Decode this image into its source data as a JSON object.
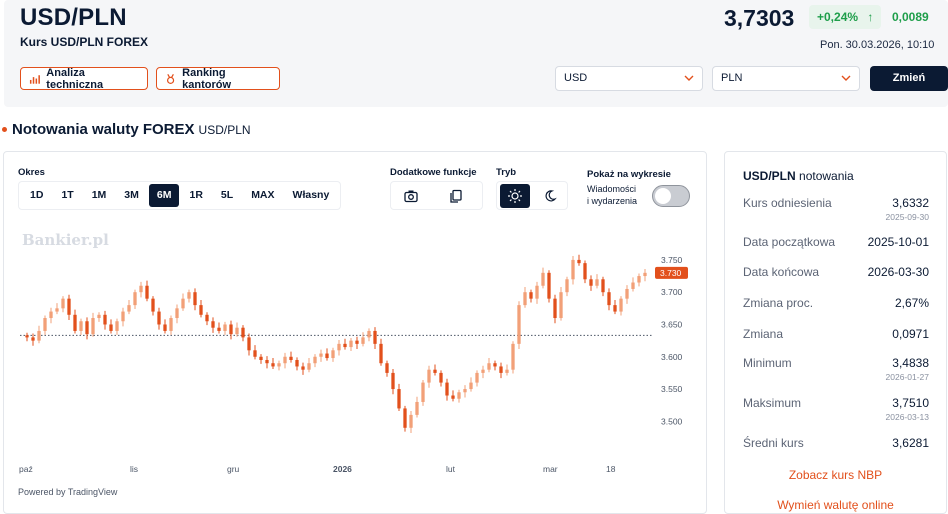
{
  "header": {
    "pair": "USD/PLN",
    "subtitle": "Kurs USD/PLN FOREX",
    "price": "3,7303",
    "change_pct": "+0,24%",
    "change_arrow": "↑",
    "change_abs": "0,0089",
    "datetime": "Pon. 30.03.2026, 10:10",
    "analysis_button": "Analiza techniczna",
    "ranking_button": "Ranking kantorów",
    "from_currency": "USD",
    "to_currency": "PLN",
    "change_button": "Zmień"
  },
  "section": {
    "title": "Notowania waluty FOREX",
    "subtitle": "USD/PLN"
  },
  "controls": {
    "period_label": "Okres",
    "periods": [
      "1D",
      "1T",
      "1M",
      "3M",
      "6M",
      "1R",
      "5L",
      "MAX",
      "Własny"
    ],
    "active_period": "6M",
    "extra_label": "Dodatkowe funkcje",
    "mode_label": "Tryb",
    "show_label": "Pokaż na wykresie",
    "toggle_label_1": "Wiadomości",
    "toggle_label_2": "i wydarzenia",
    "toggle_on": false
  },
  "chart_data": {
    "type": "candlestick",
    "watermark": "Bankier.pl",
    "powered_by": "Powered by TradingView",
    "x_tick_labels": [
      "paź",
      "lis",
      "gru",
      "2026",
      "lut",
      "mar",
      "18"
    ],
    "y_ticks": [
      "3.750",
      "3.700",
      "3.650",
      "3.600",
      "3.550",
      "3.500"
    ],
    "y_range": [
      3.468,
      3.77
    ],
    "reference_level": 3.6332,
    "last_price_label": "3.730",
    "last_price": 3.73,
    "closes": [
      3.63,
      3.625,
      3.64,
      3.66,
      3.67,
      3.675,
      3.69,
      3.665,
      3.64,
      3.655,
      3.635,
      3.66,
      3.665,
      3.65,
      3.64,
      3.655,
      3.67,
      3.68,
      3.7,
      3.71,
      3.69,
      3.67,
      3.65,
      3.64,
      3.66,
      3.675,
      3.69,
      3.7,
      3.68,
      3.665,
      3.655,
      3.645,
      3.64,
      3.65,
      3.635,
      3.645,
      3.63,
      3.61,
      3.6,
      3.595,
      3.59,
      3.585,
      3.59,
      3.6,
      3.595,
      3.585,
      3.58,
      3.59,
      3.6,
      3.605,
      3.598,
      3.61,
      3.62,
      3.615,
      3.625,
      3.62,
      3.63,
      3.64,
      3.62,
      3.59,
      3.575,
      3.55,
      3.52,
      3.49,
      3.51,
      3.53,
      3.56,
      3.58,
      3.575,
      3.56,
      3.54,
      3.535,
      3.545,
      3.55,
      3.56,
      3.575,
      3.58,
      3.59,
      3.585,
      3.575,
      3.58,
      3.62,
      3.68,
      3.7,
      3.69,
      3.71,
      3.73,
      3.69,
      3.66,
      3.7,
      3.72,
      3.75,
      3.745,
      3.72,
      3.71,
      3.72,
      3.7,
      3.68,
      3.67,
      3.69,
      3.705,
      3.715,
      3.725,
      3.73
    ],
    "positive_color": "#f2a078",
    "negative_color": "#e2501c",
    "reference_color": "#4b5566"
  },
  "stats": {
    "title_pair": "USD/PLN",
    "title_rest": "notowania",
    "rows": [
      {
        "label": "Kurs odniesienia",
        "value": "3,6332",
        "date": "2025-09-30"
      },
      {
        "label": "Data początkowa",
        "value": "2025-10-01",
        "date": ""
      },
      {
        "label": "Data końcowa",
        "value": "2026-03-30",
        "date": ""
      },
      {
        "label": "Zmiana proc.",
        "value": "2,67%",
        "date": ""
      },
      {
        "label": "Zmiana",
        "value": "0,0971",
        "date": ""
      },
      {
        "label": "Minimum",
        "value": "3,4838",
        "date": "2026-01-27"
      },
      {
        "label": "Maksimum",
        "value": "3,7510",
        "date": "2026-03-13"
      },
      {
        "label": "Średni kurs",
        "value": "3,6281",
        "date": ""
      }
    ],
    "link_nbp": "Zobacz kurs NBP",
    "link_exchange": "Wymień walutę online"
  },
  "colors": {
    "accent": "#e2501c",
    "positive": "#1e9e4a",
    "dark": "#0b1a33"
  }
}
